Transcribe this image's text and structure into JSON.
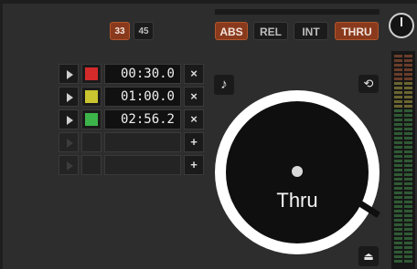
{
  "speed": {
    "rpm33": "33",
    "rpm45": "45"
  },
  "modes": {
    "abs": "ABS",
    "rel": "REL",
    "int": "INT",
    "thru": "THRU"
  },
  "cues": [
    {
      "time": "00:30.0",
      "color": "#d42a2a",
      "action": "×"
    },
    {
      "time": "01:00.0",
      "color": "#c9c430",
      "action": "×"
    },
    {
      "time": "02:56.2",
      "color": "#3db44a",
      "action": "×"
    },
    {
      "time": "",
      "color": "",
      "action": "+"
    },
    {
      "time": "",
      "color": "",
      "action": "+"
    }
  ],
  "platter": {
    "label": "Thru"
  },
  "icons": {
    "note": "music-note-icon",
    "loop": "loop-icon",
    "eject": "eject-icon"
  },
  "colors": {
    "accent": "#8a3a1c",
    "background": "#2d2d2d"
  }
}
